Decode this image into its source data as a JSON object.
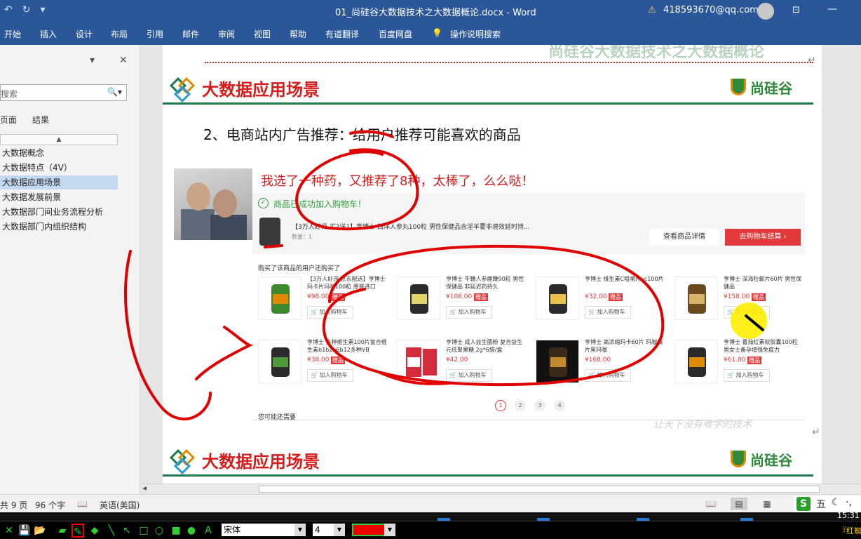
{
  "titlebar": {
    "document_title": "01_尚硅谷大数据技术之大数据概论.docx  -  Word",
    "account": "418593670@qq.com"
  },
  "ribbon_tabs": [
    "开始",
    "插入",
    "设计",
    "布局",
    "引用",
    "邮件",
    "审阅",
    "视图",
    "帮助",
    "有道翻译",
    "百度网盘",
    "操作说明搜索"
  ],
  "navpane": {
    "search_placeholder": "搜索",
    "view_pages": "页面",
    "view_results": "结果",
    "headings": [
      {
        "label": "大数据概念",
        "active": false
      },
      {
        "label": "大数据特点（4V）",
        "active": false
      },
      {
        "label": "大数据应用场景",
        "active": true
      },
      {
        "label": "大数据发展前景",
        "active": false
      },
      {
        "label": "大数据部门间业务流程分析",
        "active": false
      },
      {
        "label": "大数据部门内组织结构",
        "active": false
      }
    ]
  },
  "slide": {
    "prev_title": "尚硅谷大数据技术之大数据概论",
    "header_title": "大数据应用场景",
    "brand": "尚硅谷",
    "subtitle": "2、电商站内广告推荐：给用户推荐可能喜欢的商品",
    "caption": "我选了一种药，又推荐了8种，太棒了，么么哒！",
    "watermark": "让天下没有难学的技术"
  },
  "cart": {
    "success_text": "商品已成功加入购物车！",
    "product_name": "【3万人好评 买2送1】亨博士 西洋人参丸100粒 男性保健品含淫羊藿非速效延时持...",
    "quantity": "数量：1",
    "detail_button": "查看商品详情",
    "checkout_button": "去购物车结算"
  },
  "recommend": {
    "title": "购买了该商品的用户还购买了",
    "add_to_cart": "加入购物车",
    "gift_tag": "赠品",
    "products": [
      {
        "name": "【3万人好评 京东配送】亨博士玛卡片玛咖100粒 原装进口",
        "price": "¥98.00",
        "gift": true,
        "color": "#3d8a2e"
      },
      {
        "name": "亨博士 牛鞭人参鹿鞭90粒 男性保健品 非延迟药持久",
        "price": "¥108.00",
        "gift": true,
        "color": "#2b2b2b"
      },
      {
        "name": "亨博士 维生素C咀嚼片vc100片",
        "price": "¥32.00",
        "gift": true,
        "color": "#3a6b2a"
      },
      {
        "name": "亨博士 深海牡蛎片60片 男性保健品",
        "price": "¥158.00",
        "gift": true,
        "color": "#6b4a1f"
      },
      {
        "name": "亨博士 多种维生素100片复合维生素b1b2b6b12多种VB",
        "price": "¥38.00",
        "gift": true,
        "color": "#2f5d2a"
      },
      {
        "name": "亨博士 成人益生菌粉 复合益生元低聚果糖 2g*6袋/盒",
        "price": "¥42.00",
        "gift": false,
        "color": "#d52b3c"
      },
      {
        "name": "亨博士 高浓缩玛卡60片 玛咖精片黑玛咖",
        "price": "¥168.00",
        "gift": false,
        "color": "#1f1f1f"
      },
      {
        "name": "亨博士 番茄红素软胶囊100粒 男女士备孕增强免疫力",
        "price": "¥61.80",
        "gift": true,
        "color": "#2b2b2b"
      }
    ],
    "pages": [
      "1",
      "2",
      "3",
      "4"
    ],
    "maybe_title": "您可能还需要"
  },
  "statusbar": {
    "page": "共 9 页",
    "words": "96 个字",
    "language": "英语(美国)",
    "ime": "五"
  },
  "annotation_toolbar": {
    "font": "宋体",
    "size": "4",
    "pen_color": "#ff0000",
    "ime_tag": "『红蜘"
  },
  "clock": "15:31"
}
